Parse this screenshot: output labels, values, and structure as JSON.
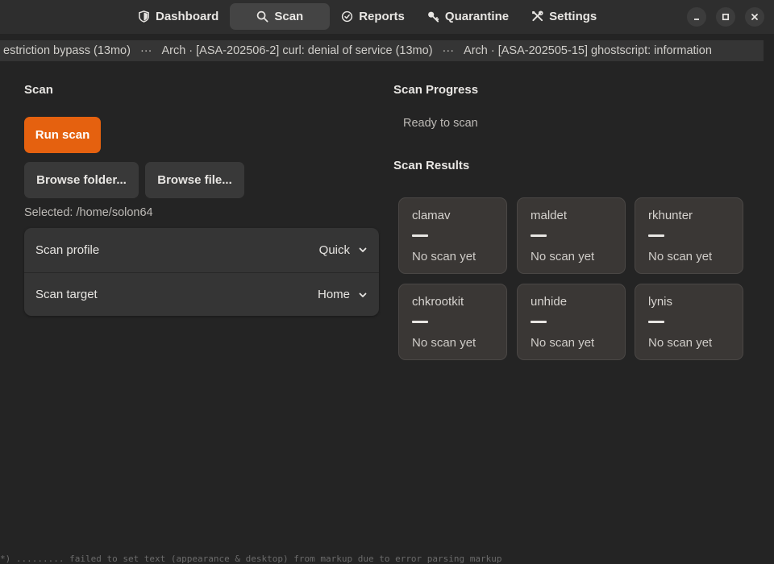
{
  "header": {
    "tabs": [
      {
        "label": "Dashboard",
        "icon": "shield-icon",
        "active": false
      },
      {
        "label": "Scan",
        "icon": "search-icon",
        "active": true
      },
      {
        "label": "Reports",
        "icon": "clock-check-icon",
        "active": false
      },
      {
        "label": "Quarantine",
        "icon": "key-icon",
        "active": false
      },
      {
        "label": "Settings",
        "icon": "tools-icon",
        "active": false
      }
    ],
    "window_controls": [
      "minimize-icon",
      "maximize-icon",
      "close-icon"
    ]
  },
  "ticker": {
    "items": [
      "estriction bypass (13mo)",
      "Arch · [ASA-202506-2] curl: denial of service (13mo)",
      "Arch · [ASA-202505-15] ghostscript: information"
    ],
    "separator": "···"
  },
  "scan": {
    "title": "Scan",
    "run_button": "Run scan",
    "browse_folder": "Browse folder...",
    "browse_file": "Browse file...",
    "selected_path": "Selected: /home/solon64",
    "options": [
      {
        "label": "Scan profile",
        "value": "Quick"
      },
      {
        "label": "Scan target",
        "value": "Home"
      }
    ]
  },
  "progress": {
    "title": "Scan Progress",
    "status": "Ready to scan"
  },
  "results": {
    "title": "Scan Results",
    "cards": [
      {
        "name": "clamav",
        "status": "No scan yet"
      },
      {
        "name": "maldet",
        "status": "No scan yet"
      },
      {
        "name": "rkhunter",
        "status": "No scan yet"
      },
      {
        "name": "chkrootkit",
        "status": "No scan yet"
      },
      {
        "name": "unhide",
        "status": "No scan yet"
      },
      {
        "name": "lynis",
        "status": "No scan yet"
      }
    ]
  },
  "log_line": "*) ......... failed to set text (appearance & desktop) from markup due to error parsing markup",
  "colors": {
    "accent": "#e5610f",
    "background": "#242424",
    "headerbar": "#2e2e2e"
  }
}
